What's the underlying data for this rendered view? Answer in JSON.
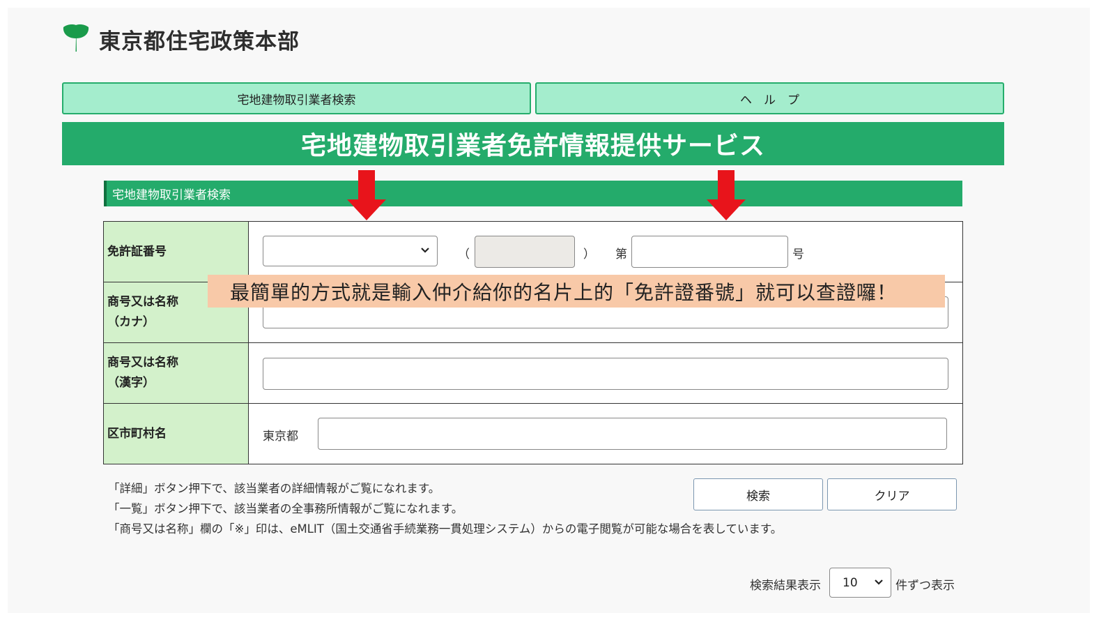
{
  "header": {
    "org_name": "東京都住宅政策本部"
  },
  "tabs": [
    {
      "label": "宅地建物取引業者検索"
    },
    {
      "label": "ヘ　ル　プ"
    }
  ],
  "banner": {
    "title": "宅地建物取引業者免許情報提供サービス"
  },
  "section": {
    "title": "宅地建物取引業者検索"
  },
  "form": {
    "license": {
      "label": "免許証番号",
      "select_value": "",
      "paren_open": "（",
      "paren_close": "）",
      "dai": "第",
      "gou": "号",
      "renewal_value": "",
      "number_value": ""
    },
    "name_kana": {
      "label_line1": "商号又は名称",
      "label_line2": "（カナ）",
      "value": ""
    },
    "name_kanji": {
      "label_line1": "商号又は名称",
      "label_line2": "（漢字）",
      "value": ""
    },
    "city": {
      "label": "区市町村名",
      "prefix": "東京都",
      "value": ""
    }
  },
  "overlay_note": "最簡單的方式就是輸入仲介給你的名片上的「免許證番號」就可以查證囉！",
  "notes": [
    "「詳細」ボタン押下で、該当業者の詳細情報がご覧になれます。",
    "「一覧」ボタン押下で、該当業者の全事務所情報がご覧になれます。",
    "「商号又は名称」欄の「※」印は、eMLIT（国土交通省手続業務一貫処理システム）からの電子閲覧が可能な場合を表しています。"
  ],
  "buttons": {
    "search": "検索",
    "clear": "クリア"
  },
  "results": {
    "label_before": "検索結果表示",
    "per_page": "10",
    "label_after": "件ずつ表示"
  },
  "colors": {
    "brand_green": "#24ab6b",
    "tab_green": "#a4edcd",
    "label_green": "#d3f1cb",
    "arrow_red": "#e8141b",
    "overlay_peach": "#f8c9a8"
  }
}
